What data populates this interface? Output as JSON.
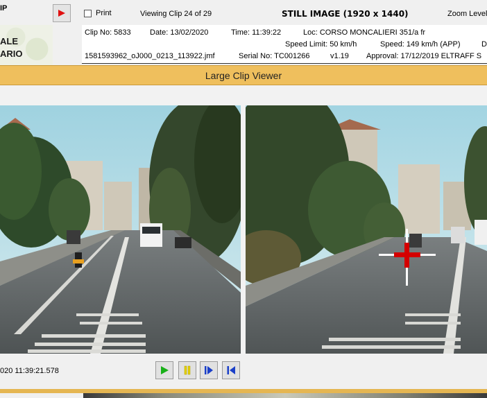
{
  "header": {
    "logo_tab": "IP",
    "logo_lines": [
      "ALE",
      "ARIO"
    ],
    "print_label": "Print",
    "viewing_text": "Viewing Clip 24 of 29",
    "image_title": "STILL IMAGE (1920 x 1440)",
    "zoom_label": "Zoom Level:"
  },
  "clip_info": {
    "clip_no": "Clip No: 5833",
    "date": "Date: 13/02/2020",
    "time": "Time: 11:39:22",
    "loc": "Loc: CORSO MONCALIERI 351/a fr",
    "speed_limit": "Speed Limit: 50 km/h",
    "speed": "Speed: 149 km/h (APP)",
    "extra": "D",
    "file": "1581593962_oJ000_0213_113922.jmf",
    "serial": "Serial No: TC001266",
    "version": "v1.19",
    "approval": "Approval: 17/12/2019 ELTRAFF S"
  },
  "viewer": {
    "title": "Large Clip Viewer"
  },
  "controls": {
    "timestamp": "020 11:39:21.578",
    "play_icon": "play-icon",
    "pause_icon": "pause-icon",
    "step_icon": "step-forward-icon",
    "first_icon": "skip-to-start-icon"
  },
  "colors": {
    "title_bar": "#efbf5d",
    "crosshair": "#d40000",
    "play_green": "#19b019",
    "pause_yellow": "#e5d000",
    "step_blue": "#1a3fc8"
  }
}
